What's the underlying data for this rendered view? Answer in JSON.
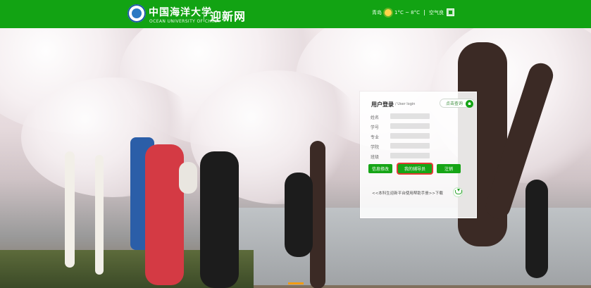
{
  "header": {
    "brand_cn": "中国海洋大学",
    "brand_en": "OCEAN UNIVERSITY OF CHINA",
    "site_title": "迎新网",
    "weather": {
      "location": "青岛",
      "temp_range": "1°C ~ 8°C",
      "air_quality": "空气良",
      "icon": "sun-icon"
    }
  },
  "login": {
    "title": "用户登录",
    "subtitle": "/ User login",
    "query_button": "点击查询",
    "fields": [
      {
        "label": "姓名",
        "value": ""
      },
      {
        "label": "学号",
        "value": ""
      },
      {
        "label": "专业",
        "value": ""
      },
      {
        "label": "学院",
        "value": ""
      },
      {
        "label": "班级",
        "value": ""
      }
    ],
    "buttons": {
      "edit_info": "信息修改",
      "my_counselor": "我的辅导员",
      "logout": "注销"
    },
    "download_text": "<<本科生迎新平台使用帮助手册>>下载"
  },
  "colors": {
    "topbar": "#12a313",
    "primary_green": "#16a516",
    "highlight_red": "#e53935"
  }
}
